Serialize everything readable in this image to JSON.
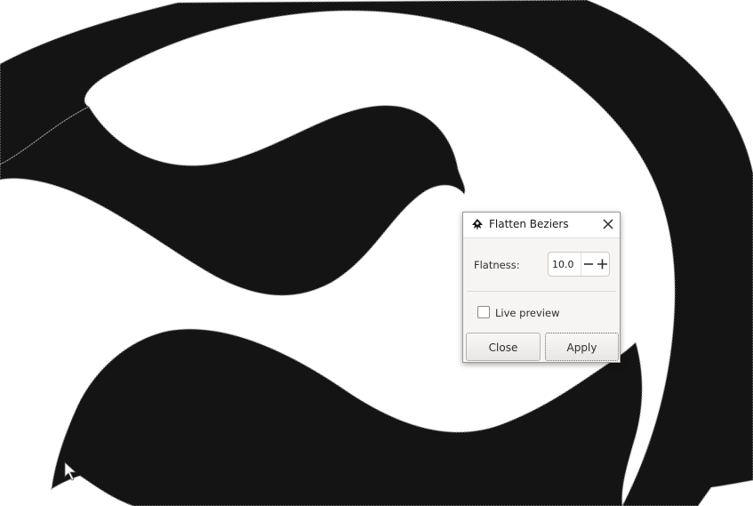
{
  "dialog": {
    "title": "Flatten Beziers",
    "app_icon": "inkscape-icon",
    "close_icon": "close-icon",
    "flatness_label": "Flatness:",
    "flatness_value": "10.0",
    "live_preview_label": "Live preview",
    "live_preview_checked": false,
    "close_button_label": "Close",
    "apply_button_label": "Apply"
  },
  "canvas": {
    "fill_color": "#141414",
    "background_color": "#ffffff"
  }
}
